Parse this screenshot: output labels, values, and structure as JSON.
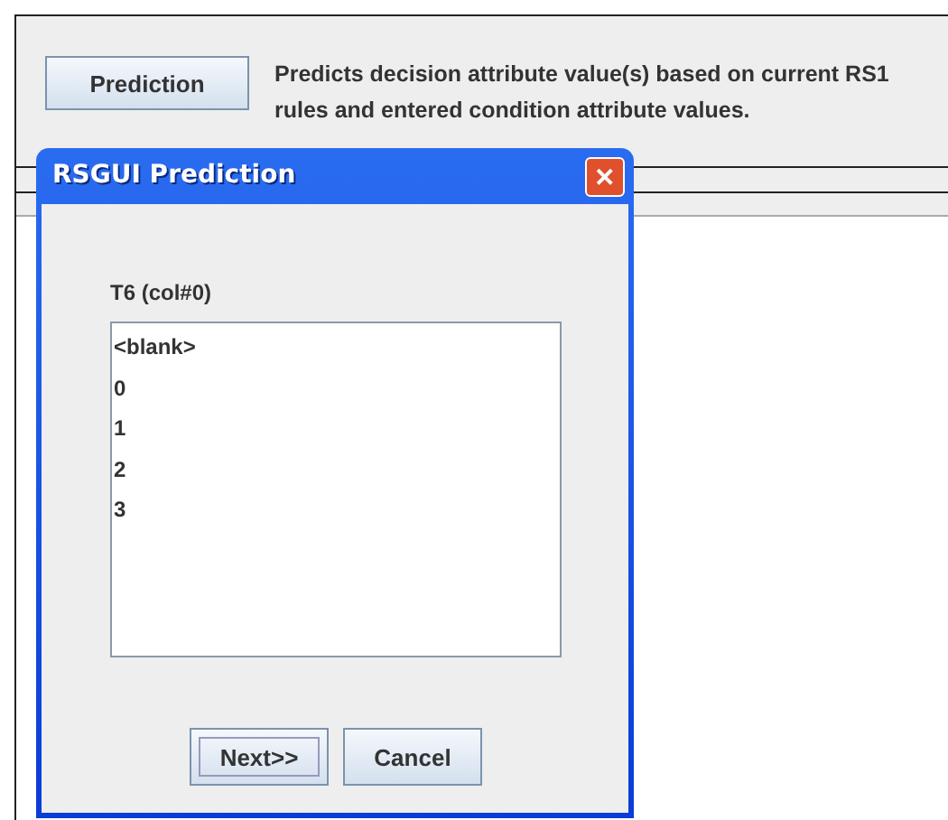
{
  "main": {
    "button": "Prediction",
    "description": "Predicts decision attribute value(s) based on current RS1 rules and entered condition attribute values."
  },
  "dialog": {
    "title": "RSGUI Prediction",
    "close": "✕",
    "label": "T6 (col#0)",
    "items": [
      {
        "text": "<blank>"
      },
      {
        "text": "0"
      },
      {
        "text": "1"
      },
      {
        "text": "2"
      },
      {
        "text": "3"
      }
    ],
    "buttons": [
      {
        "label": "Next>>",
        "focused": true
      },
      {
        "label": "Cancel",
        "focused": false
      }
    ]
  }
}
